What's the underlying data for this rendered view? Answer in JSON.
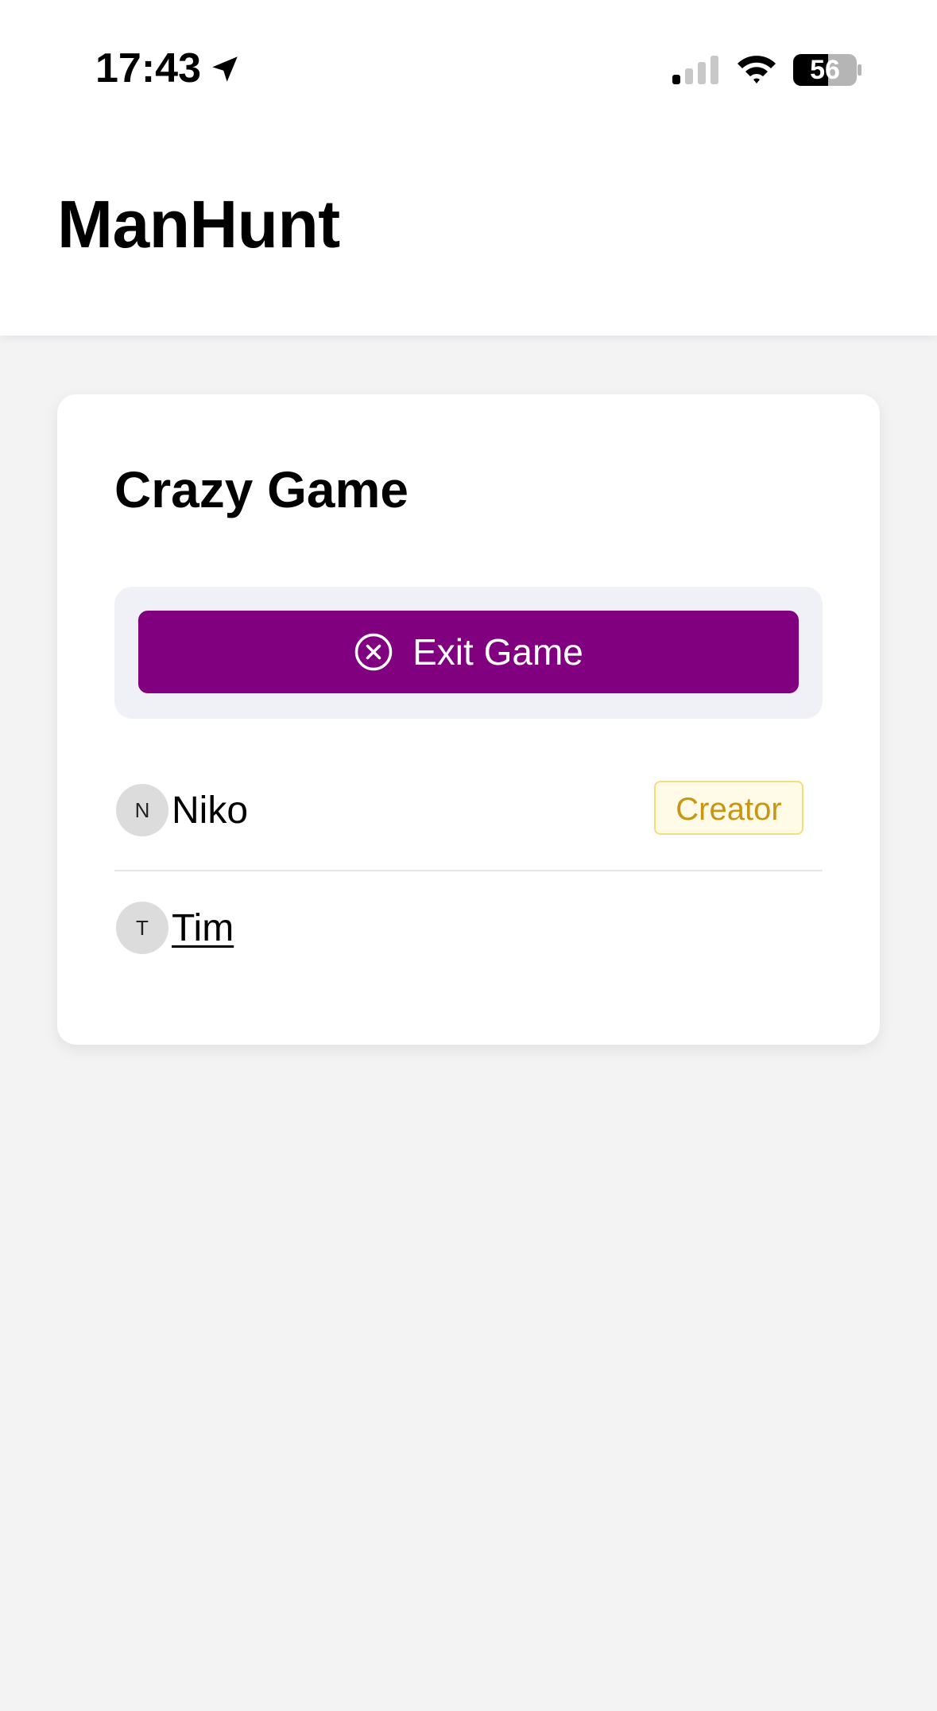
{
  "status_bar": {
    "time": "17:43",
    "battery": "56",
    "icons": [
      "location-arrow-icon",
      "cellular-signal-icon",
      "wifi-icon",
      "battery-icon"
    ]
  },
  "header": {
    "title": "ManHunt"
  },
  "game": {
    "title": "Crazy Game",
    "exit_label": "Exit Game",
    "exit_icon": "close-circle-icon",
    "accent_color": "#800080",
    "players": [
      {
        "initial": "N",
        "name": "Niko",
        "badge": "Creator"
      },
      {
        "initial": "T",
        "name": "Tim"
      }
    ]
  }
}
